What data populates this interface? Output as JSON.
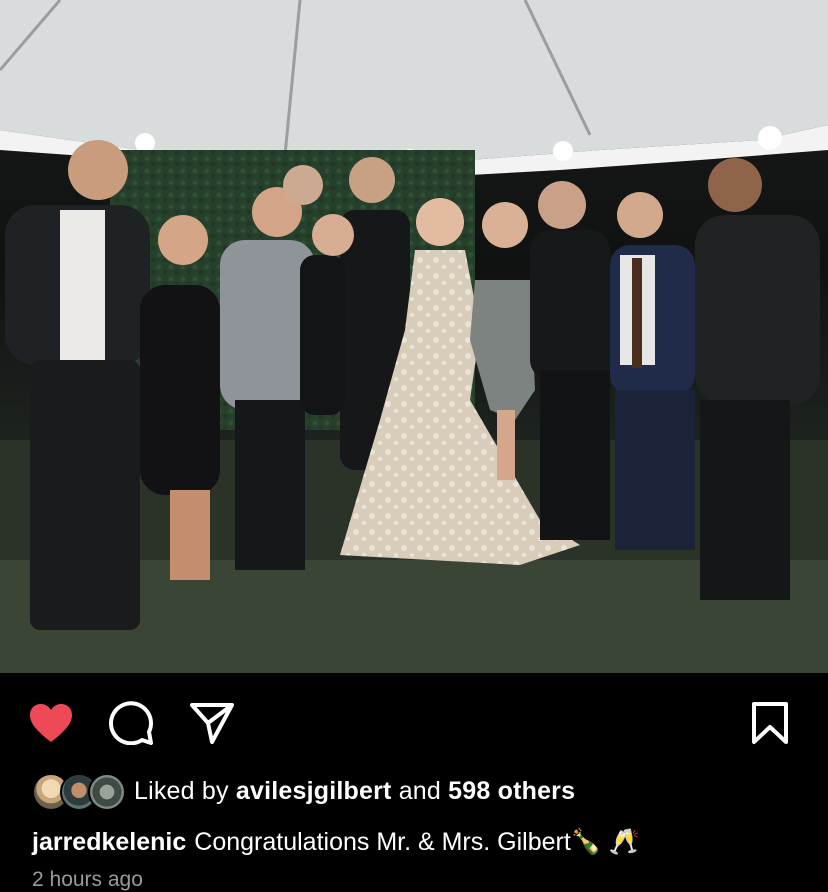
{
  "post": {
    "image_alt": "Group photo of wedding party under a tent at night",
    "liked_by_prefix": "Liked by",
    "liked_by_user": "avilesjgilbert",
    "liked_by_middle": "and",
    "liked_by_count": "598 others",
    "caption_user": "jarredkelenic",
    "caption_text": "Congratulations Mr. & Mrs. Gilbert🍾 🥂",
    "timestamp": "2 hours ago"
  },
  "icons": {
    "like": "heart-icon",
    "comment": "comment-bubble-icon",
    "share": "paper-plane-icon",
    "save": "bookmark-icon"
  },
  "colors": {
    "background": "#000000",
    "heart": "#ed4956",
    "text": "#ffffff",
    "muted": "#9a9a9a"
  }
}
